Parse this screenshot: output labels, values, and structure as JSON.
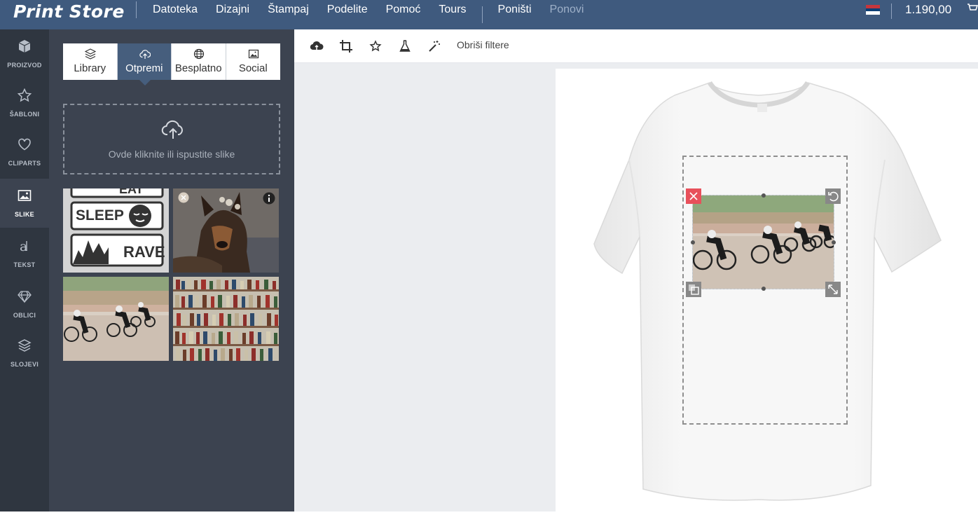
{
  "brand": {
    "logo": "Print Store"
  },
  "menu": {
    "items": [
      "Datoteka",
      "Dizajni",
      "Štampaj",
      "Podelite",
      "Pomoć",
      "Tours"
    ],
    "undo": "Poništi",
    "redo": "Ponovi"
  },
  "header": {
    "price": "1.190,00"
  },
  "rail": {
    "items": [
      {
        "label": "PROIZVOD",
        "icon": "cube-icon"
      },
      {
        "label": "ŠABLONI",
        "icon": "star-icon"
      },
      {
        "label": "CLIPARTS",
        "icon": "heart-icon"
      },
      {
        "label": "SLIKE",
        "icon": "image-icon",
        "active": true
      },
      {
        "label": "TEKST",
        "icon": "text-icon"
      },
      {
        "label": "OBLICI",
        "icon": "diamond-icon"
      },
      {
        "label": "SLOJEVI",
        "icon": "layers-icon"
      }
    ]
  },
  "panel": {
    "tabs": [
      {
        "label": "Library",
        "icon": "layers-icon"
      },
      {
        "label": "Otpremi",
        "icon": "cloud-upload-icon",
        "active": true
      },
      {
        "label": "Besplatno",
        "icon": "globe-icon"
      },
      {
        "label": "Social",
        "icon": "image-icon"
      }
    ],
    "dropzone": {
      "text": "Ovde kliknite ili ispustite slike"
    },
    "thumb_text": {
      "eat": "EAT",
      "sleep": "SLEEP",
      "rave": "RAVE"
    }
  },
  "toolbar": {
    "clear_filters": "Obriši filtere"
  },
  "colors": {
    "topbar": "#3f5a7e",
    "rail": "#2f3640",
    "panel": "#3c4350",
    "active_tab": "#465e7d",
    "delete": "#e8505b"
  }
}
